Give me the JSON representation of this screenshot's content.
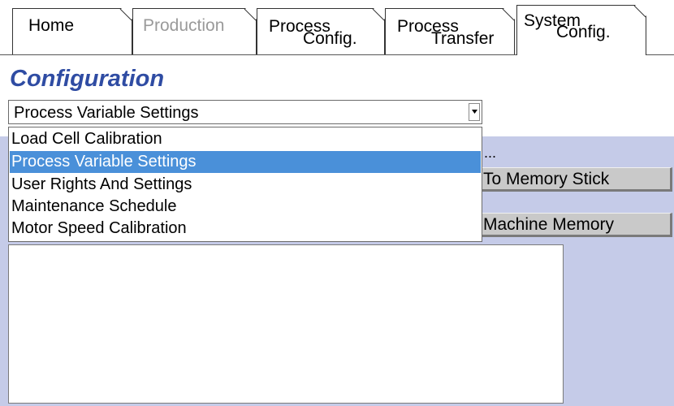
{
  "tabs": [
    {
      "line1": "Home",
      "line2": "",
      "state": "normal"
    },
    {
      "line1": "Production",
      "line2": "",
      "state": "disabled"
    },
    {
      "line1": "Process",
      "line2": "Config.",
      "state": "normal"
    },
    {
      "line1": "Process",
      "line2": "Transfer",
      "state": "normal"
    },
    {
      "line1": "System",
      "line2": "Config.",
      "state": "active"
    }
  ],
  "page": {
    "title": "Configuration"
  },
  "select": {
    "value": "Process Variable Settings"
  },
  "dropdown": {
    "options": [
      "Load Cell Calibration",
      "Process Variable Settings",
      "User Rights And Settings",
      "Maintenance Schedule",
      "Motor Speed Calibration"
    ],
    "selected_index": 1
  },
  "panel": {
    "status_text": "...",
    "button1_label": "To Memory Stick",
    "button2_label": "Machine Memory",
    "log_text": ""
  },
  "colors": {
    "heading": "#2f4ca3",
    "panel_bg": "#c5cbe8",
    "selected_option": "#4a90d9",
    "disabled_tab_text": "#9a9a9a"
  }
}
